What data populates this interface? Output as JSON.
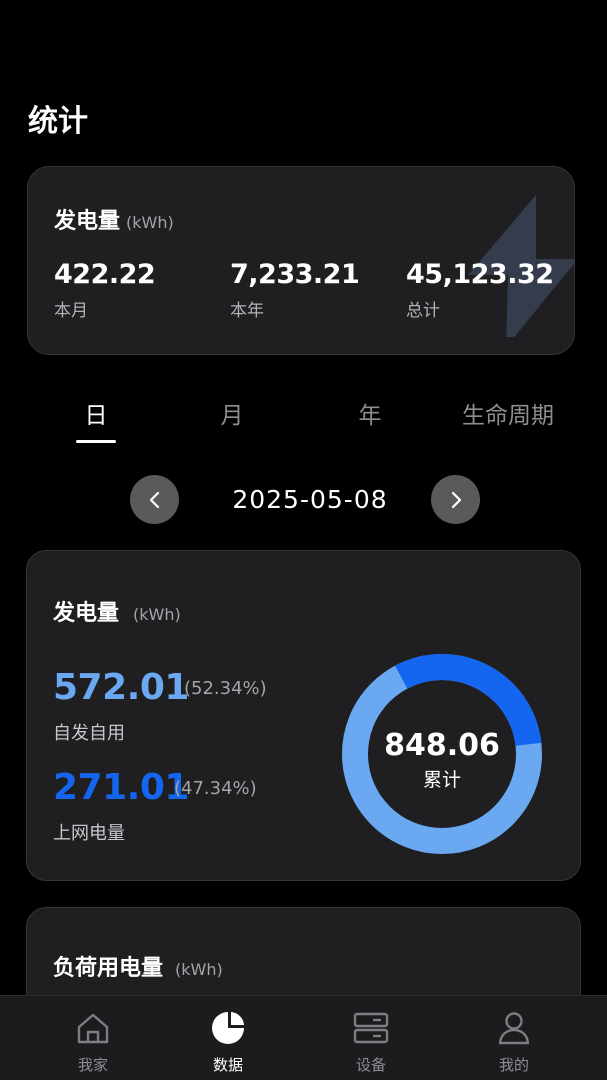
{
  "page": {
    "title": "统计"
  },
  "summary": {
    "heading": "发电量",
    "unit": "(kWh)",
    "stats": [
      {
        "value": "422.22",
        "label": "本月"
      },
      {
        "value": "7,233.21",
        "label": "本年"
      },
      {
        "value": "45,123.32",
        "label": "总计"
      }
    ],
    "icon": "lightning-bolt-icon"
  },
  "tabs": [
    {
      "label": "日",
      "active": true
    },
    {
      "label": "月",
      "active": false
    },
    {
      "label": "年",
      "active": false
    },
    {
      "label": "生命周期",
      "active": false
    }
  ],
  "date_nav": {
    "date": "2025-05-08",
    "prev_icon": "chevron-left-icon",
    "next_icon": "chevron-right-icon"
  },
  "generation": {
    "heading": "发电量",
    "unit": "(kWh)",
    "self_use": {
      "value": "572.01",
      "percent": "(52.34%)",
      "label": "自发自用",
      "color": "#6aa8f2"
    },
    "grid": {
      "value": "271.01",
      "percent": "(47.34%)",
      "label": "上网电量",
      "color": "#1466f0"
    },
    "total": {
      "value": "848.06",
      "label": "累计"
    },
    "donut_fractions": {
      "self_use": 0.5234,
      "grid": 0.4766
    }
  },
  "load": {
    "heading": "负荷用电量",
    "unit": "(kWh)"
  },
  "bottom_nav": [
    {
      "label": "我家",
      "icon": "home-icon",
      "active": false
    },
    {
      "label": "数据",
      "icon": "pie-chart-icon",
      "active": true
    },
    {
      "label": "设备",
      "icon": "device-server-icon",
      "active": false
    },
    {
      "label": "我的",
      "icon": "user-icon",
      "active": false
    }
  ],
  "colors": {
    "background": "#000000",
    "card": "#1f1f21",
    "accent_light": "#6aa8f2",
    "accent_dark": "#1466f0"
  }
}
